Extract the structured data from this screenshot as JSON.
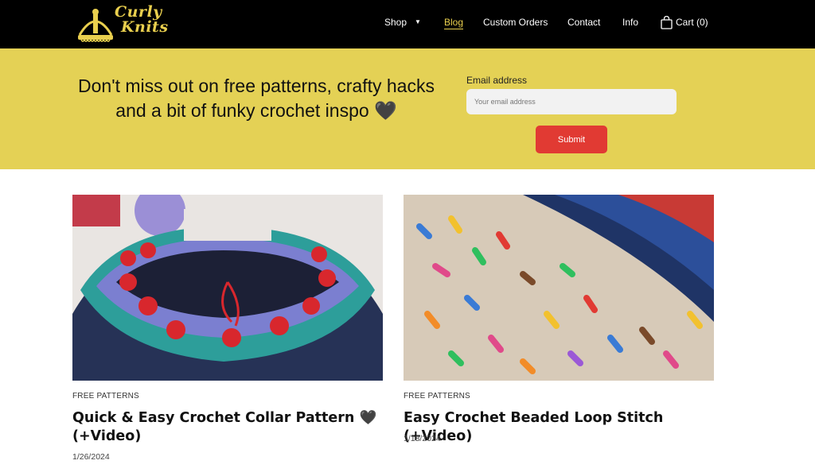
{
  "brand": {
    "logo_line1": "Curly",
    "logo_line2": "Knits",
    "accent_color": "#e9cf4e"
  },
  "nav": {
    "items": [
      {
        "label": "Shop"
      },
      {
        "label": "Blog"
      },
      {
        "label": "Custom Orders"
      },
      {
        "label": "Contact"
      },
      {
        "label": "Info"
      }
    ],
    "cart_label": "Cart (0)",
    "caret": "▼"
  },
  "newsletter": {
    "headline": "Don't miss out on free patterns, crafty hacks and a bit of funky crochet inspo 🖤",
    "email_label": "Email address",
    "email_placeholder": "Your email address",
    "submit_label": "Submit",
    "band_color": "#e4d155",
    "button_color": "#e13a33"
  },
  "posts": [
    {
      "category": "FREE PATTERNS",
      "title": "Quick & Easy Crochet Collar Pattern 🖤 (+Video)",
      "date": "1/26/2024"
    },
    {
      "category": "FREE PATTERNS",
      "title": "Easy Crochet Beaded Loop Stitch (+Video)",
      "date": "1/18/2024"
    }
  ]
}
